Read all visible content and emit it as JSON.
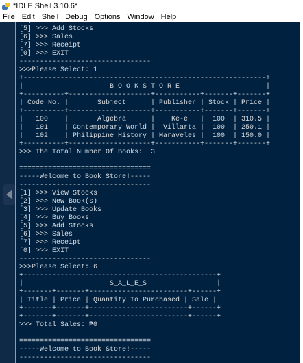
{
  "window": {
    "title": "*IDLE Shell 3.10.6*"
  },
  "menu": [
    "File",
    "Edit",
    "Shell",
    "Debug",
    "Options",
    "Window",
    "Help"
  ],
  "console": {
    "lines": [
      "[4] >>> Buy Books",
      "[5] >>> Add Stocks",
      "[6] >>> Sales",
      "[7] >>> Receipt",
      "[0] >>> EXIT",
      "--------------------------------",
      ">>>Please Select: 1",
      "+-----------------------------------------------------------+",
      "|                     B_O_O_K S_T_O_R_E                     |",
      "+----------+--------------------+-----------+-------+-------+",
      "| Code No. |       Subject      | Publisher | Stock | Price |",
      "+----------+--------------------+-----------+-------+-------+",
      "|   100    |       Algebra      |    Ke-e   |  100  | 310.5 |",
      "|   101    | Contemporary World |  Villarta |  100  | 250.1 |",
      "|   102    | Philippine History | Maraveles |  100  | 150.0 |",
      "+----------+--------------------+-----------+-------+-------+",
      ">>> The Total Number Of Books:  3",
      "",
      "================================",
      "-----Welcome to Book Store!-----",
      "--------------------------------",
      "[1] >>> View Stocks",
      "[2] >>> New Book(s)",
      "[3] >>> Update Books",
      "[4] >>> Buy Books",
      "[5] >>> Add Stocks",
      "[6] >>> Sales",
      "[7] >>> Receipt",
      "[0] >>> EXIT",
      "--------------------------------",
      ">>>Please Select: 6",
      "+-----------------------------------------------+",
      "|                     S_A_L_E_S                 |",
      "+-------+-------+------------------------+------+",
      "| Title | Price | Quantity To Purchased | Sale |",
      "+-------+-------+------------------------+------+",
      "+-------+-------+------------------------+------+",
      ">>> Total Sales: ₱0",
      "",
      "================================",
      "-----Welcome to Book Store!-----",
      "--------------------------------"
    ]
  },
  "colors": {
    "shell_bg": "#002240",
    "text": "#d7dbe0",
    "gutter": "#0f2a47"
  }
}
